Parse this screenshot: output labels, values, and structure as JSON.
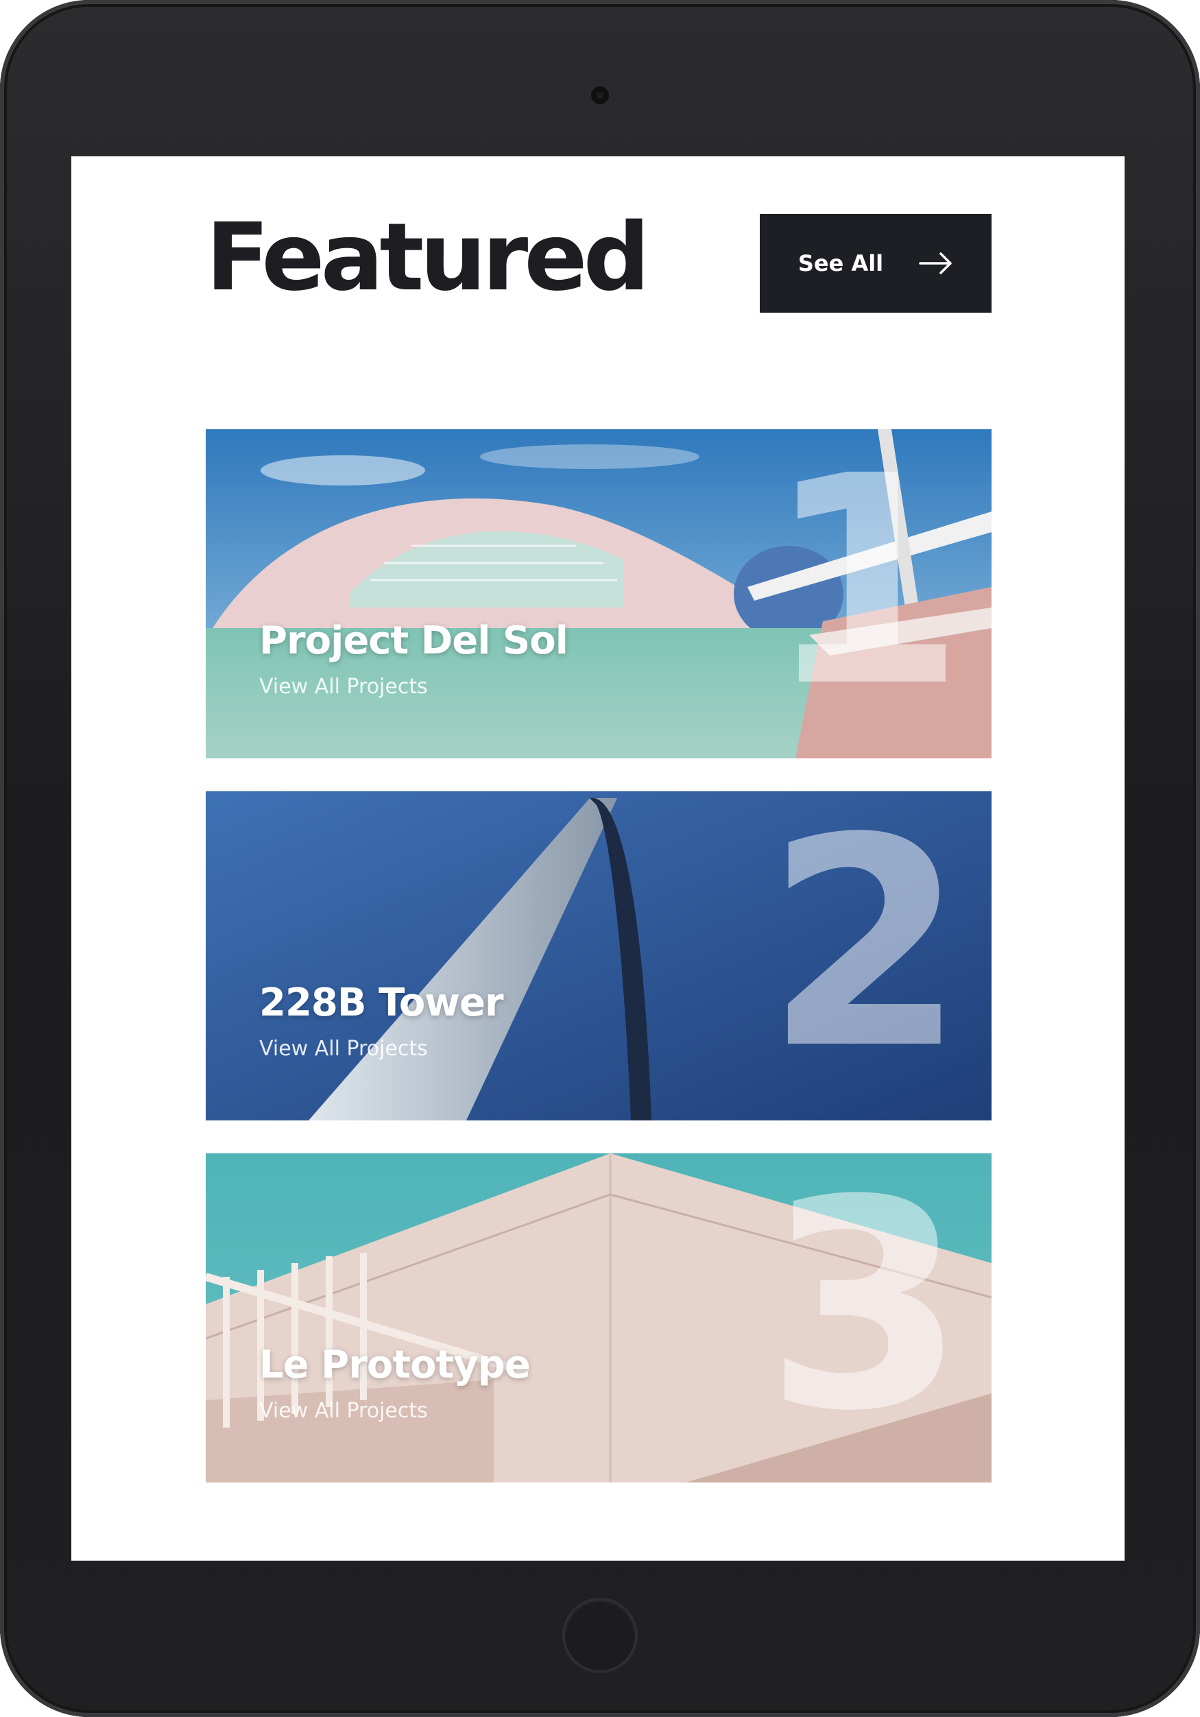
{
  "header": {
    "title": "Featured",
    "see_all_label": "See All"
  },
  "projects": [
    {
      "number": "1",
      "title": "Project Del Sol",
      "link": "View All Projects"
    },
    {
      "number": "2",
      "title": "228B Tower",
      "link": "View All Projects"
    },
    {
      "number": "3",
      "title": "Le Prototype",
      "link": "View All Projects"
    }
  ],
  "colors": {
    "button_bg": "#1e1f24",
    "title_text": "#1d1d22",
    "device_frame": "#1c1c1e"
  }
}
